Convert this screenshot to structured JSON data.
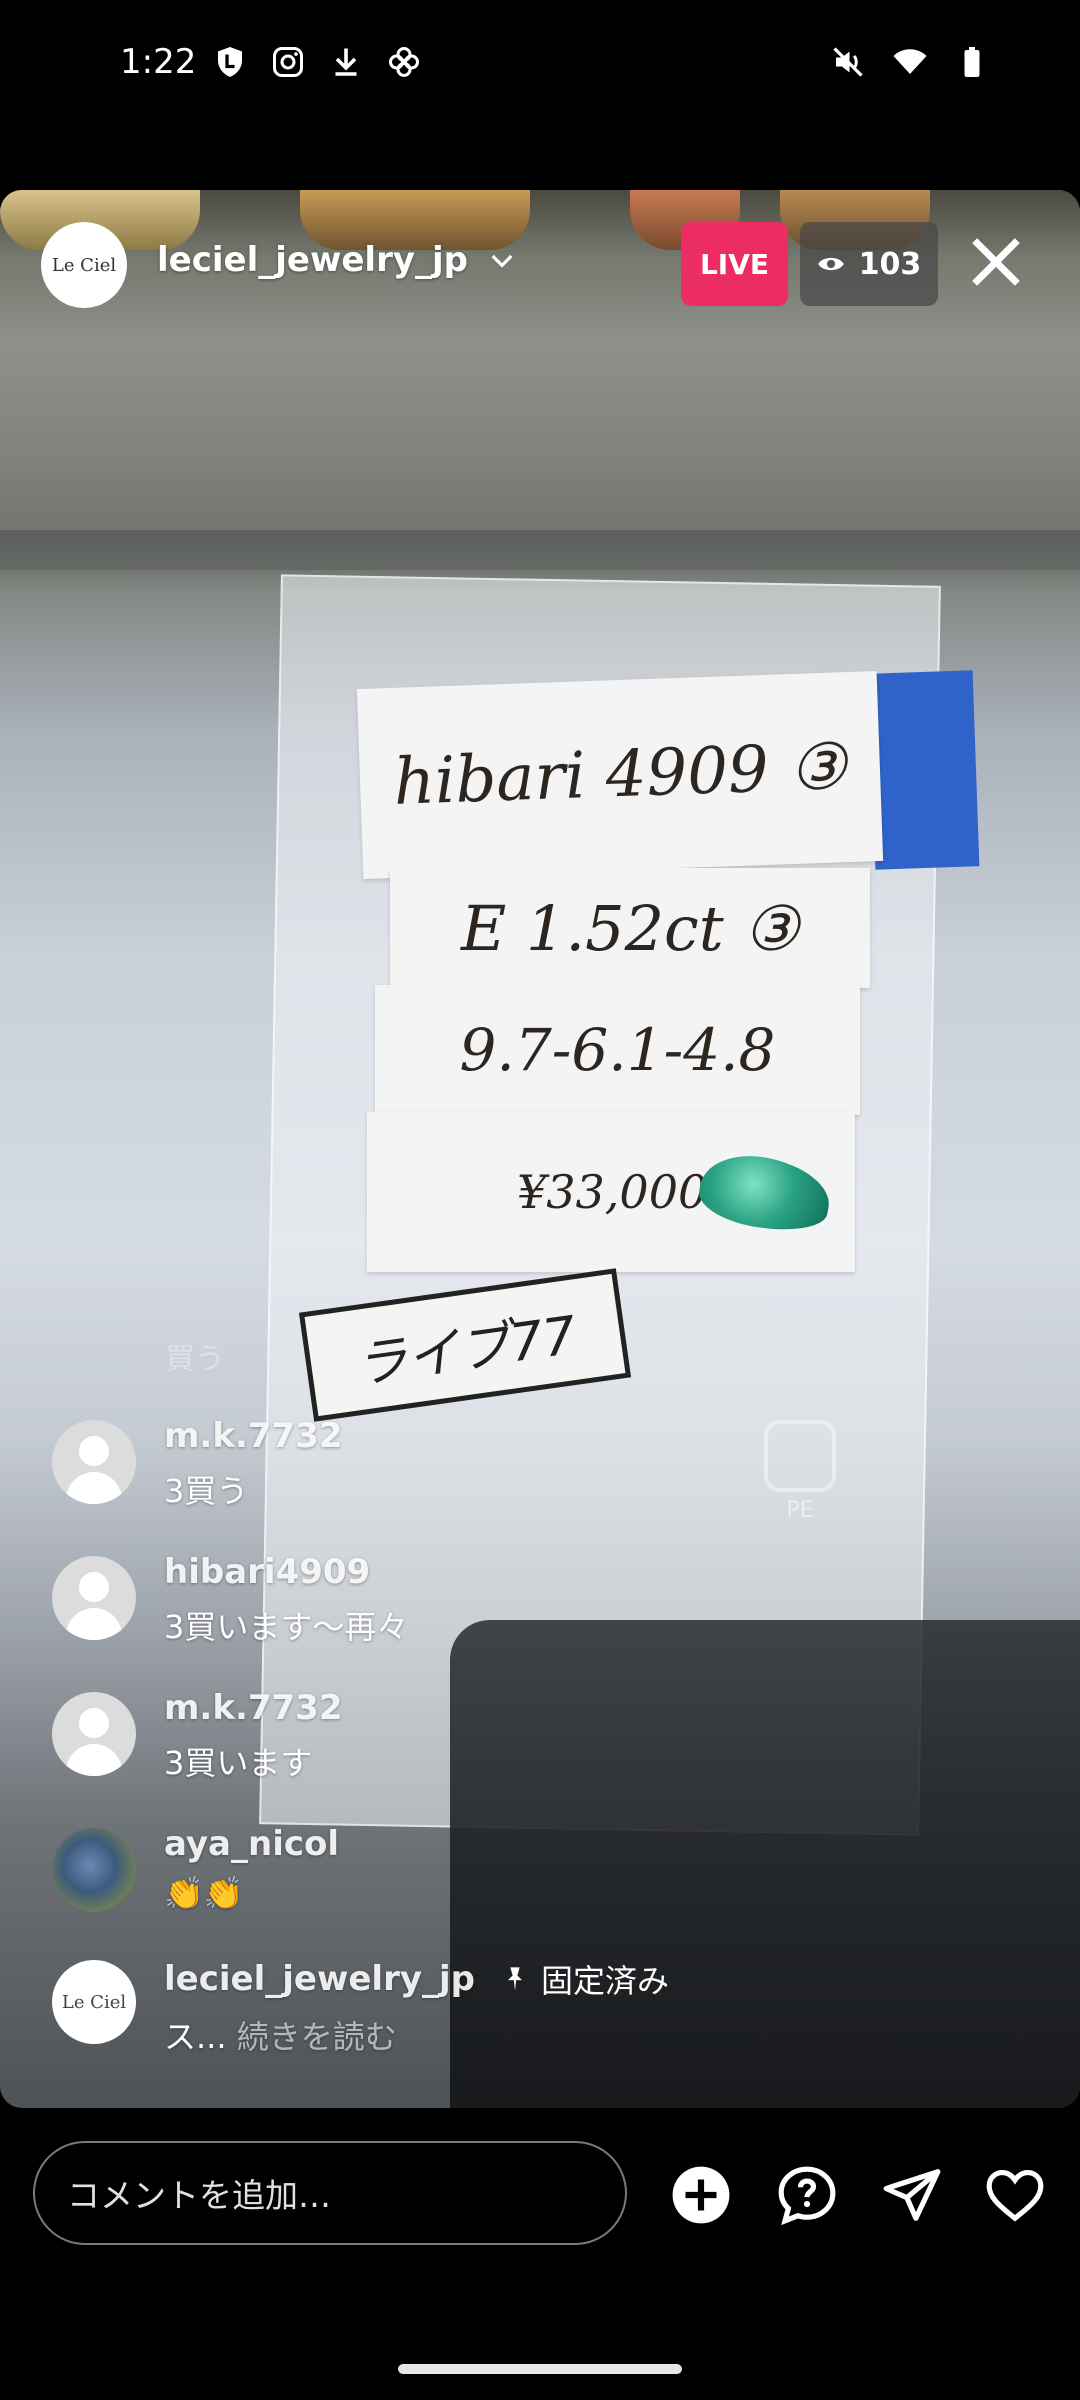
{
  "status_bar": {
    "time": "1:22",
    "left_icons": [
      "shield-l-icon",
      "instagram-icon",
      "download-icon",
      "pinwheel-icon"
    ],
    "right_icons": [
      "mute-icon",
      "wifi-icon",
      "battery-icon"
    ]
  },
  "live": {
    "avatar_text": "Le Ciel",
    "username": "leciel_jewelry_jp",
    "live_label": "LIVE",
    "viewer_count": "103"
  },
  "scene": {
    "tag_1": "hibari 4909 ③",
    "tag_2": "E 1.52ct ③",
    "tag_3": "9.7-6.1-4.8",
    "tag_4": "¥33,000",
    "label_box": "ライブ77",
    "bag_mark": "PE",
    "gem_color": "#2aa384"
  },
  "comments": {
    "faded": "買う",
    "items": [
      {
        "user": "m.k.7732",
        "text": "3買う",
        "avatar": "default"
      },
      {
        "user": "hibari4909",
        "text": "3買います〜再々",
        "avatar": "default"
      },
      {
        "user": "m.k.7732",
        "text": "3買います",
        "avatar": "default"
      },
      {
        "user": "aya_nicol",
        "text": "👏👏",
        "avatar": "photo"
      }
    ],
    "pinned": {
      "user": "leciel_jewelry_jp",
      "pin_label": "固定済み",
      "text": "ス...",
      "read_more": "続きを読む",
      "avatar_text": "Le Ciel"
    }
  },
  "bottom_bar": {
    "placeholder": "コメントを追加…",
    "icons": [
      "add-circle-icon",
      "question-bubble-icon",
      "send-icon",
      "heart-icon"
    ]
  },
  "colors": {
    "live_badge": "#ec2d63",
    "blue_tab": "#2f63c9"
  }
}
